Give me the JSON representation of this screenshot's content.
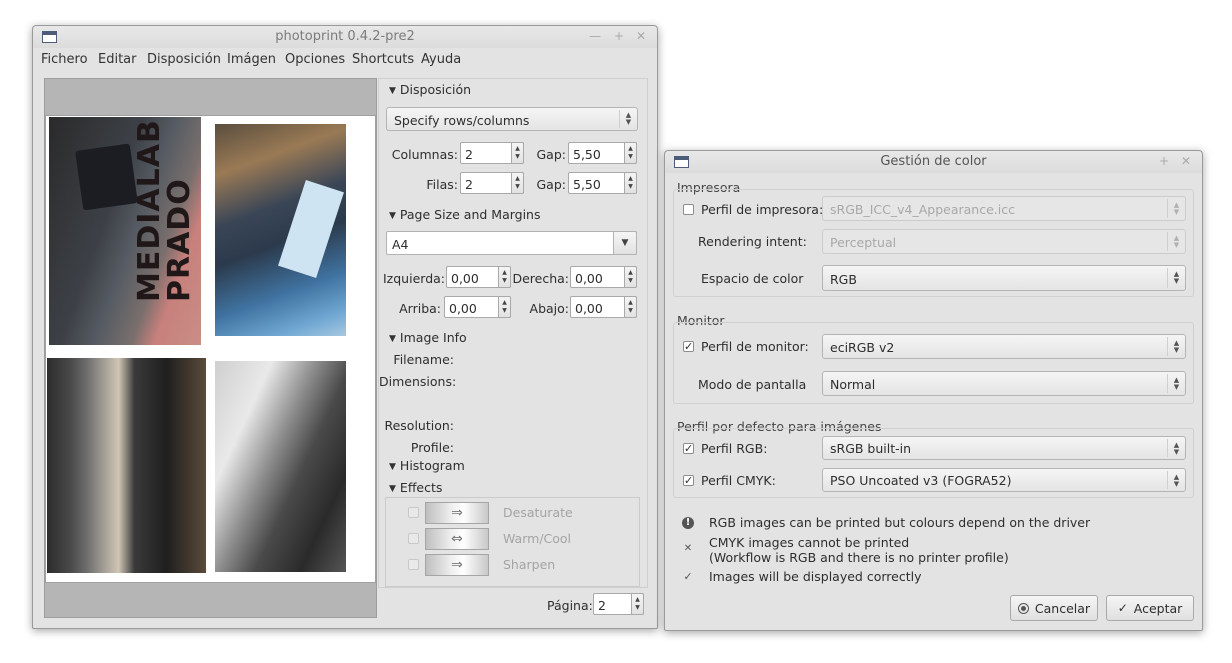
{
  "main_window": {
    "title": "photoprint 0.4.2-pre2",
    "menu": [
      "Fichero",
      "Editar",
      "Disposición",
      "Imágen",
      "Opciones",
      "Shortcuts",
      "Ayuda"
    ],
    "preview_photos": [
      {
        "text": "MEDIALAB PRADO"
      },
      {
        "text": ""
      },
      {
        "text": ""
      },
      {
        "text": ""
      }
    ],
    "layout": {
      "section_title": "Disposición",
      "mode": "Specify rows/columns",
      "columns_label": "Columnas:",
      "columns_value": "2",
      "rows_label": "Filas:",
      "rows_value": "2",
      "gap_label": "Gap:",
      "gap_columns_value": "5,50",
      "gap_rows_value": "5,50"
    },
    "page": {
      "section_title": "Page Size and Margins",
      "size": "A4",
      "left_label": "Izquierda:",
      "left_value": "0,00",
      "right_label": "Derecha:",
      "right_value": "0,00",
      "top_label": "Arriba:",
      "top_value": "0,00",
      "bottom_label": "Abajo:",
      "bottom_value": "0,00"
    },
    "image_info": {
      "section_title": "Image Info",
      "filename_label": "Filename:",
      "dimensions_label": "Dimensions:",
      "resolution_label": "Resolution:",
      "profile_label": "Profile:"
    },
    "histogram": {
      "section_title": "Histogram"
    },
    "effects": {
      "section_title": "Effects",
      "items": [
        {
          "label": "Desaturate",
          "glyph": "⇒"
        },
        {
          "label": "Warm/Cool",
          "glyph": "⇔"
        },
        {
          "label": "Sharpen",
          "glyph": "⇒"
        }
      ]
    },
    "page_nav": {
      "label": "Página:",
      "value": "2"
    }
  },
  "color_dialog": {
    "title": "Gestión de color",
    "printer_group": {
      "title": "Impresora",
      "printer_profile_label": "Perfil de impresora:",
      "printer_profile_value": "sRGB_ICC_v4_Appearance.icc",
      "rendering_intent_label": "Rendering intent:",
      "rendering_intent_value": "Perceptual",
      "color_space_label": "Espacio de color",
      "color_space_value": "RGB"
    },
    "monitor_group": {
      "title": "Monitor",
      "monitor_profile_label": "Perfil de monitor:",
      "monitor_profile_value": "eciRGB v2",
      "display_mode_label": "Modo de pantalla",
      "display_mode_value": "Normal"
    },
    "default_group": {
      "title": "Perfil por defecto para imágenes",
      "rgb_label": "Perfil RGB:",
      "rgb_value": "sRGB built-in",
      "cmyk_label": "Perfil CMYK:",
      "cmyk_value": "PSO Uncoated v3 (FOGRA52)"
    },
    "status": {
      "rgb": "RGB images can be printed but colours depend on the driver",
      "cmyk_line1": "CMYK images cannot be printed",
      "cmyk_line2": "(Workflow is RGB and there is no printer profile)",
      "display": "Images will be displayed correctly"
    },
    "buttons": {
      "cancel": "Cancelar",
      "accept": "Aceptar"
    }
  }
}
